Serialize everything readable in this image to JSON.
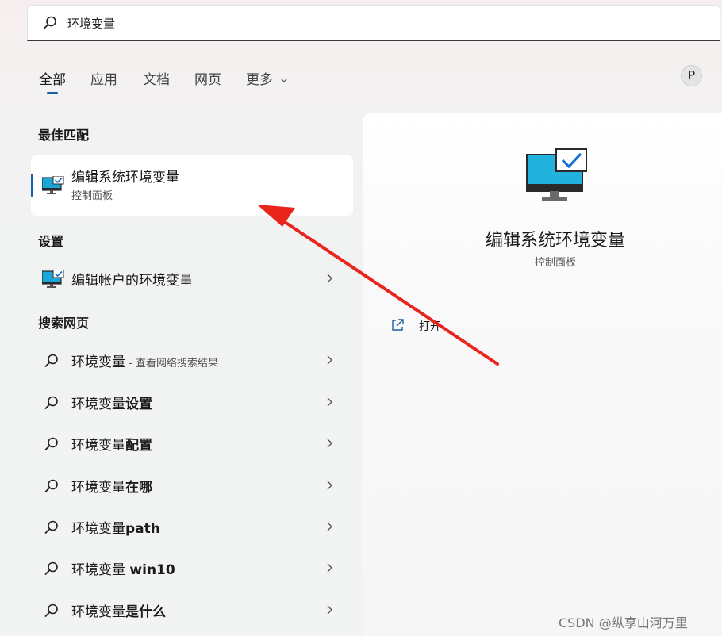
{
  "search": {
    "query": "环境变量"
  },
  "tabs": [
    "全部",
    "应用",
    "文档",
    "网页",
    "更多"
  ],
  "user": {
    "avatar_letter": "P"
  },
  "sections": {
    "best_match": "最佳匹配",
    "settings": "设置",
    "web": "搜索网页"
  },
  "best_match": {
    "title": "编辑系统环境变量",
    "subtitle": "控制面板"
  },
  "settings_items": [
    {
      "label": "编辑帐户的环境变量"
    }
  ],
  "web_results": [
    {
      "base": "环境变量",
      "bold": "",
      "hint": " - 查看网络搜索结果"
    },
    {
      "base": "环境变量",
      "bold": "设置",
      "hint": ""
    },
    {
      "base": "环境变量",
      "bold": "配置",
      "hint": ""
    },
    {
      "base": "环境变量",
      "bold": "在哪",
      "hint": ""
    },
    {
      "base": "环境变量",
      "bold": "path",
      "hint": ""
    },
    {
      "base": "环境变量 ",
      "bold": "win10",
      "hint": ""
    },
    {
      "base": "环境变量",
      "bold": "是什么",
      "hint": ""
    }
  ],
  "preview": {
    "title": "编辑系统环境变量",
    "subtitle": "控制面板",
    "action_open": "打开"
  },
  "watermark": "CSDN @纵享山河万里",
  "colors": {
    "accent": "#1a5fa8",
    "arrow": "#e8241c",
    "monitor": "#1aa6d6"
  }
}
